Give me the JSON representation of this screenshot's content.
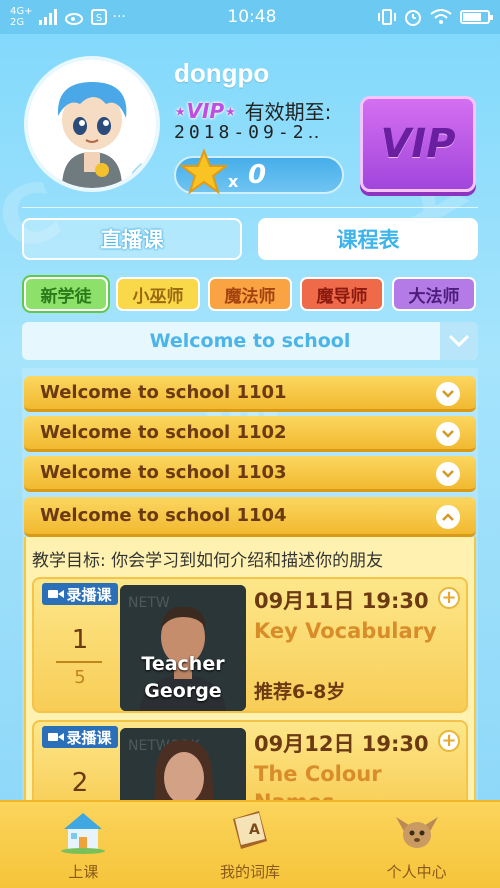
{
  "status_bar": {
    "network_top": "4G+",
    "network_bottom": "2G",
    "time": "10:48"
  },
  "profile": {
    "username": "dongpo",
    "vip_tag": "VIP",
    "vip_valid_label": "有效期至:",
    "vip_date": "2018-09-2‥",
    "star_multiplier": "x",
    "star_count": "0",
    "vip_button_label": "VIP"
  },
  "tabs": {
    "live": "直播课",
    "schedule": "课程表",
    "active": "schedule"
  },
  "levels": [
    "新学徒",
    "小巫师",
    "魔法师",
    "魔导师",
    "大法师"
  ],
  "course_selector": {
    "selected": "Welcome to school"
  },
  "units": [
    {
      "title": "Welcome to school 1101",
      "expanded": false
    },
    {
      "title": "Welcome to school 1102",
      "expanded": false
    },
    {
      "title": "Welcome to school 1103",
      "expanded": false
    },
    {
      "title": "Welcome to school 1104",
      "expanded": true
    }
  ],
  "unit_goal": "教学目标: 你会学习到如何介绍和描述你的朋友",
  "lessons": [
    {
      "badge": "录播课",
      "number": "1",
      "total": "5",
      "teacher": "Teacher George",
      "time": "09月11日 19:30",
      "title": "Key Vocabulary",
      "age": "推荐6-8岁"
    },
    {
      "badge": "录播课",
      "number": "2",
      "total": "",
      "teacher": "",
      "time": "09月12日 19:30",
      "title": "The Colour Names",
      "age": ""
    }
  ],
  "bottom_nav": {
    "class": "上课",
    "vocab": "我的词库",
    "profile": "个人中心"
  },
  "colors": {
    "background": "#8bd6f8",
    "accent_yellow": "#f6c43a",
    "text_brown": "#6b3a13",
    "vip_purple": "#a146dc"
  }
}
